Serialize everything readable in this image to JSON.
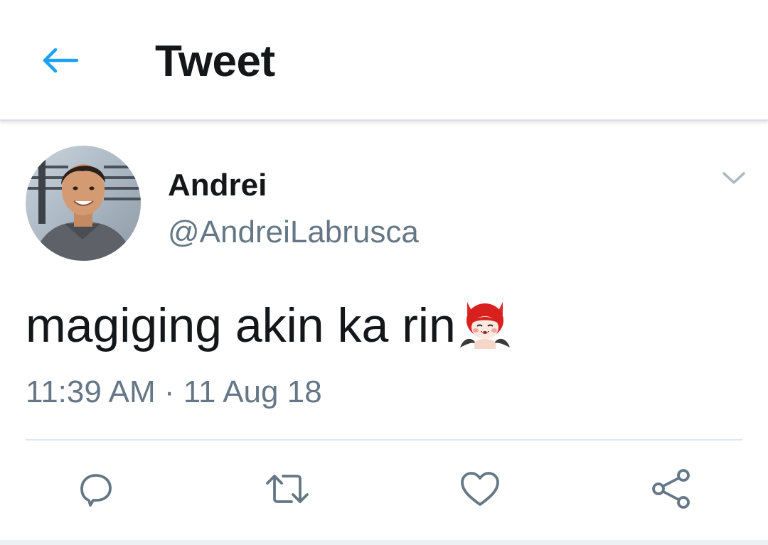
{
  "header": {
    "title": "Tweet",
    "back_icon": "back-arrow-icon"
  },
  "tweet": {
    "author_name": "Andrei",
    "author_handle": "@AndreiLabrusca",
    "text": "magiging akin ka rin",
    "emoji": "devil-face-emoji",
    "timestamp": "11:39 AM · 11 Aug 18"
  },
  "actions": [
    {
      "name": "reply",
      "icon": "reply-icon"
    },
    {
      "name": "retweet",
      "icon": "retweet-icon"
    },
    {
      "name": "like",
      "icon": "heart-icon"
    },
    {
      "name": "share",
      "icon": "share-icon"
    }
  ],
  "colors": {
    "accent": "#1da1f2",
    "text_primary": "#14171a",
    "text_secondary": "#657786",
    "divider": "#e1e8ed"
  }
}
